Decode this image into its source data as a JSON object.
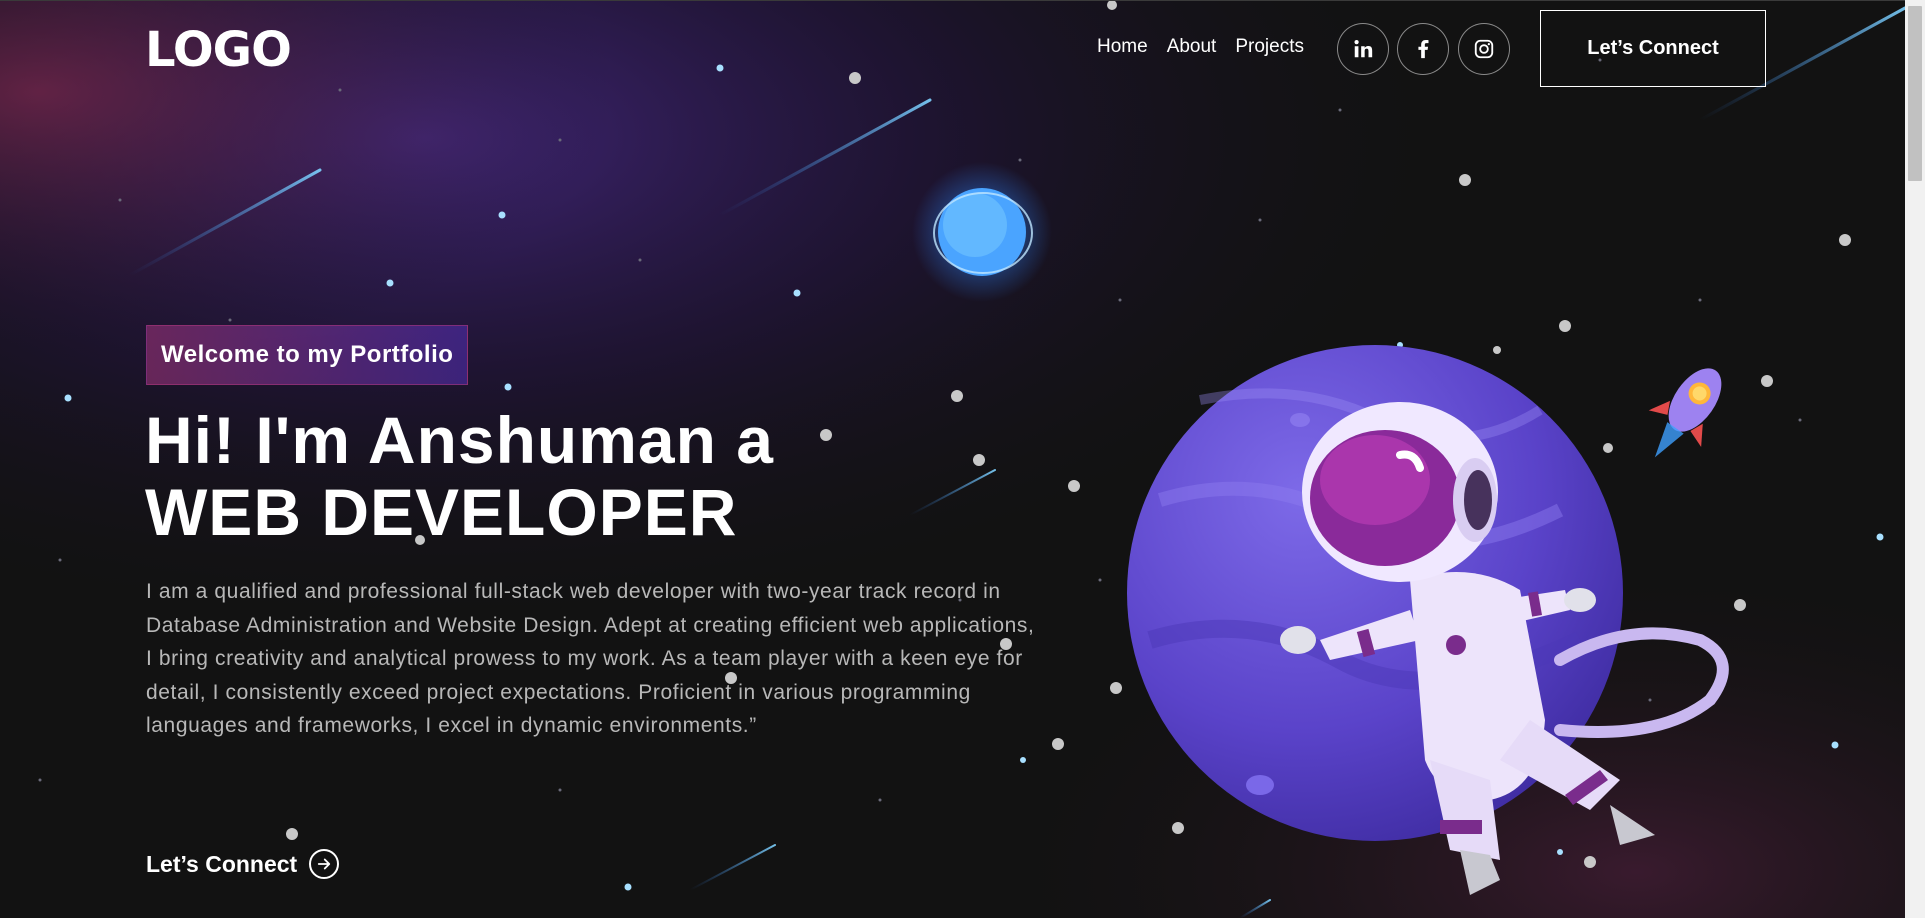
{
  "nav": {
    "logo": "LOGO",
    "links": [
      "Home",
      "About",
      "Projects"
    ],
    "social": [
      "linkedin-icon",
      "facebook-icon",
      "instagram-icon"
    ],
    "cta": "Let’s Connect"
  },
  "hero": {
    "tagline": "Welcome to my Portfolio",
    "title_line1": "Hi! I'm Anshuman a",
    "title_line2": "WEB DEVELOPER",
    "description": "I am a qualified and professional full-stack web developer with two-year track record in Database Administration and Website Design. Adept at creating efficient web applications, I bring creativity and analytical prowess to my work. As a team player with a keen eye for detail, I consistently exceed project expectations. Proficient in various programming languages and frameworks, I excel in dynamic environments.”",
    "cta": "Let’s Connect"
  },
  "colors": {
    "background": "#121212",
    "purple": "#6a4de0",
    "magenta": "#aa367c",
    "text_muted": "#b8b8b8"
  }
}
